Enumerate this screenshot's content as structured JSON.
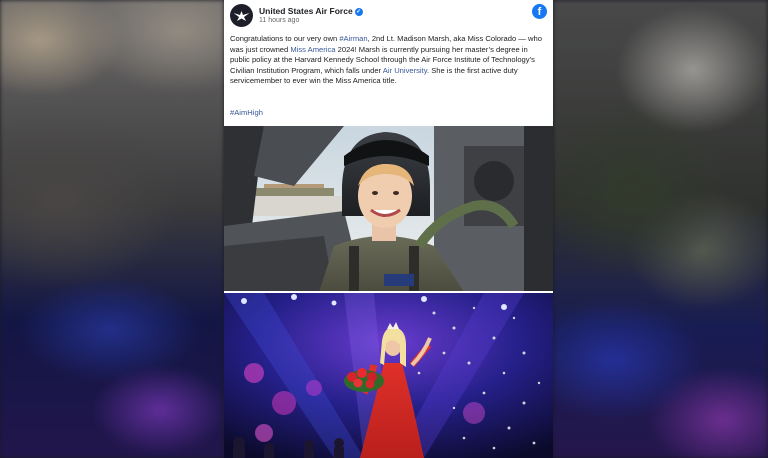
{
  "post": {
    "author": "United States Air Force",
    "timestamp": "11 hours ago",
    "text_parts": [
      {
        "t": "Congratulations to our very own ",
        "link": false
      },
      {
        "t": "#Airman",
        "link": true
      },
      {
        "t": ", 2nd Lt. Madison Marsh, aka Miss Colorado — who was just crowned ",
        "link": false
      },
      {
        "t": "Miss America",
        "link": true
      },
      {
        "t": " 2024! Marsh is currently pursuing her master’s degree in public policy at the Harvard Kennedy School through the Air Force Institute of Technology’s Civilian Institution Program, which falls under ",
        "link": false
      },
      {
        "t": "Air University",
        "link": true
      },
      {
        "t": ". She is the first active duty servicemember to ever win the Miss America title.",
        "link": false
      }
    ],
    "hashtag": "#AimHigh"
  },
  "icons": {
    "avatar": "air-force-logo-icon",
    "verified": "verified-badge-icon",
    "facebook": "facebook-icon"
  },
  "colors": {
    "link": "#385898",
    "facebook_blue": "#1877f2"
  }
}
